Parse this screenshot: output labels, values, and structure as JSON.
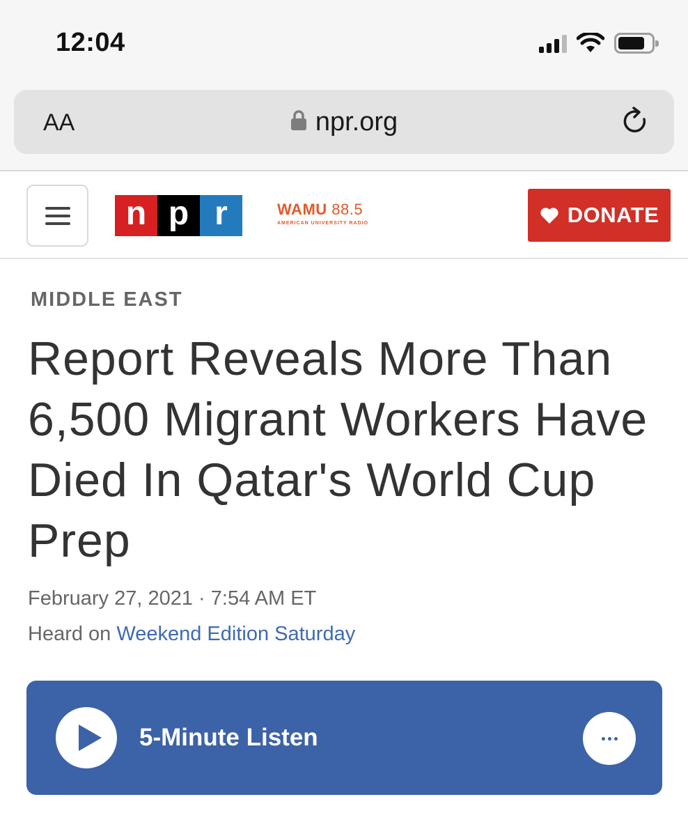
{
  "status_bar": {
    "time": "12:04"
  },
  "browser": {
    "text_size_label": "AA",
    "url": "npr.org"
  },
  "site_header": {
    "logo_letters": [
      "n",
      "p",
      "r"
    ],
    "station_name": "WAMU",
    "station_frequency": "88.5",
    "station_tagline": "AMERICAN UNIVERSITY RADIO",
    "donate_label": "DONATE",
    "colors": {
      "npr_red": "#d62021",
      "npr_black": "#000000",
      "npr_blue": "#237bbd",
      "donate": "#d22f27",
      "wamu_orange": "#e05a2b"
    }
  },
  "article": {
    "section": "MIDDLE EAST",
    "headline": "Report Reveals More Than 6,500 Migrant Workers Have Died In Qatar's World Cup Prep",
    "dateline": "February 27, 2021 · 7:54 AM ET",
    "heard_on_prefix": "Heard on",
    "program": "Weekend Edition Saturday"
  },
  "player": {
    "listen_label": "5-Minute Listen",
    "color": "#3c62a8"
  }
}
